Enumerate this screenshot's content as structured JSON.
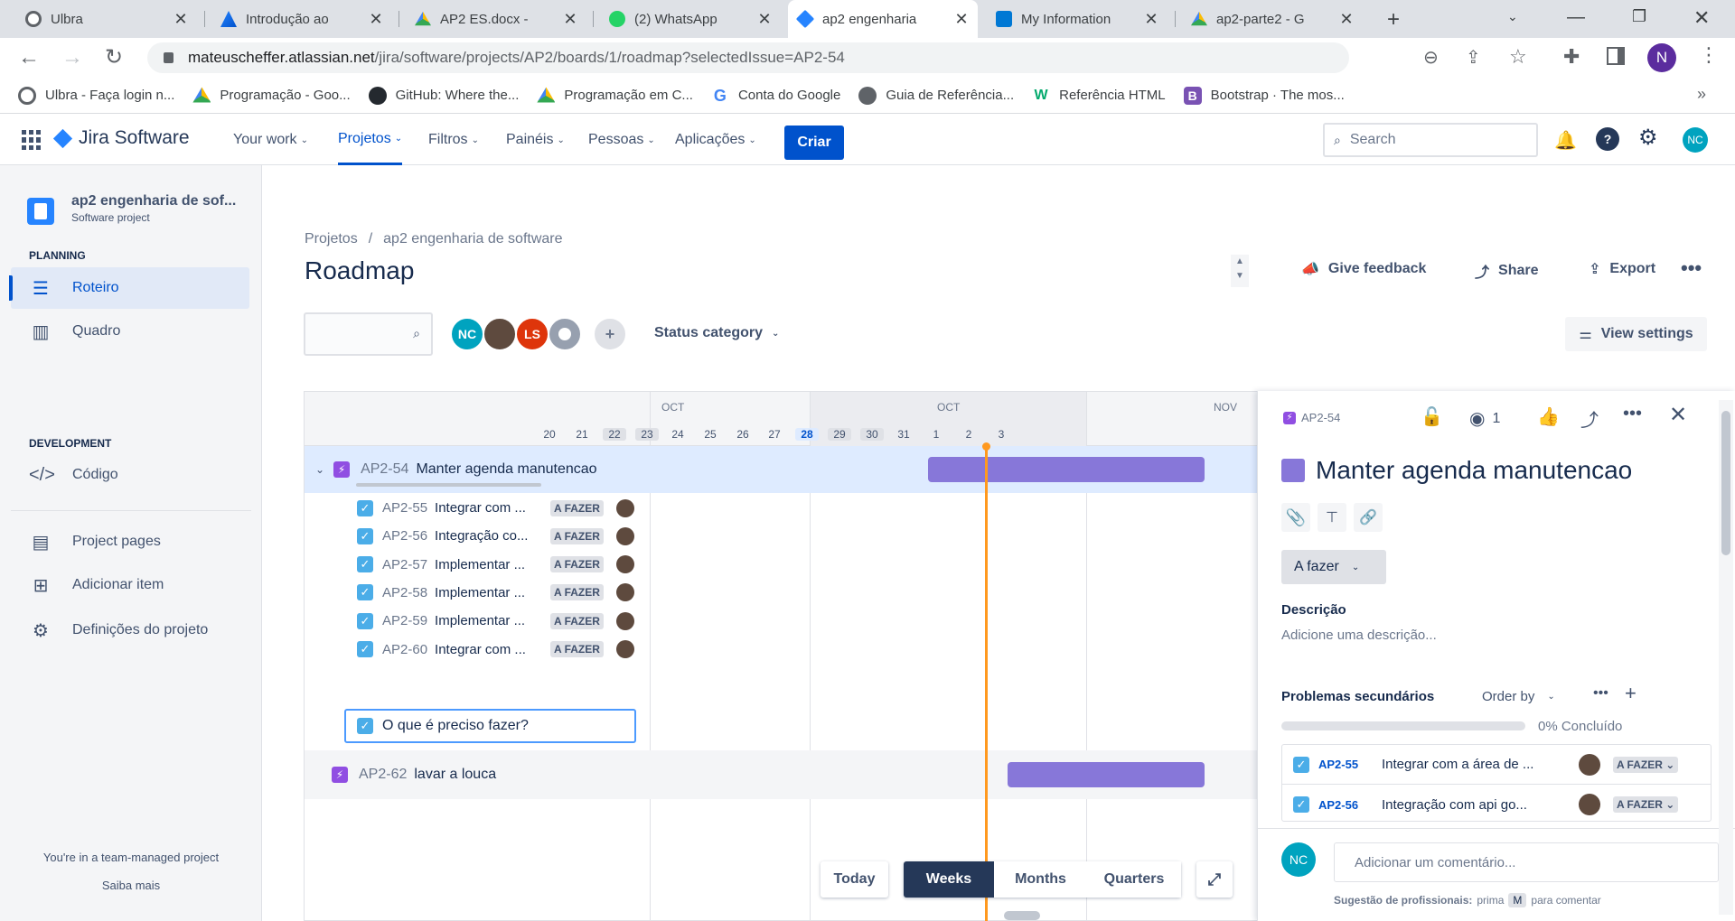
{
  "browser": {
    "tabs": [
      {
        "title": "Ulbra",
        "icon": "openai-icon",
        "active": false
      },
      {
        "title": "Introdução ao",
        "icon": "atlassian-icon",
        "active": false
      },
      {
        "title": "AP2 ES.docx - ",
        "icon": "google-drive-icon",
        "active": false
      },
      {
        "title": "(2) WhatsApp",
        "icon": "whatsapp-icon",
        "active": false
      },
      {
        "title": "ap2 engenharia",
        "icon": "jira-icon",
        "active": true
      },
      {
        "title": "My Information",
        "icon": "azure-devops-icon",
        "active": false
      },
      {
        "title": "ap2-parte2 - G",
        "icon": "google-drive-icon",
        "active": false
      }
    ],
    "url_host": "mateuscheffer.atlassian.net",
    "url_path": "/jira/software/projects/AP2/boards/1/roadmap?selectedIssue=AP2-54",
    "profile_initial": "N",
    "bookmarks": [
      {
        "label": "Ulbra - Faça login n...",
        "icon": "openai-icon"
      },
      {
        "label": "Programação - Goo...",
        "icon": "google-drive-icon"
      },
      {
        "label": "GitHub: Where the...",
        "icon": "github-icon"
      },
      {
        "label": "Programação em C...",
        "icon": "google-drive-icon"
      },
      {
        "label": "Conta do Google",
        "icon": "google-icon"
      },
      {
        "label": "Guia de Referência...",
        "icon": "globe-icon"
      },
      {
        "label": "Referência HTML",
        "icon": "w3schools-icon"
      },
      {
        "label": "Bootstrap · The mos...",
        "icon": "bootstrap-icon"
      }
    ]
  },
  "jira": {
    "product": "Jira Software",
    "nav": [
      "Your work",
      "Projetos",
      "Filtros",
      "Painéis",
      "Pessoas",
      "Aplicações"
    ],
    "create_label": "Criar",
    "search_placeholder": "Search",
    "user_initials": "NC"
  },
  "sidebar": {
    "project_name": "ap2 engenharia de sof...",
    "project_type": "Software project",
    "planning_head": "PLANNING",
    "development_head": "DEVELOPMENT",
    "items": [
      {
        "label": "Roteiro",
        "icon": "roadmap-icon"
      },
      {
        "label": "Quadro",
        "icon": "board-icon"
      },
      {
        "label": "Código",
        "icon": "code-icon"
      },
      {
        "label": "Project pages",
        "icon": "page-icon"
      },
      {
        "label": "Adicionar item",
        "icon": "add-item-icon"
      },
      {
        "label": "Definições do projeto",
        "icon": "settings-icon"
      }
    ],
    "footer_note": "You're in a team-managed project",
    "footer_link": "Saiba mais"
  },
  "main": {
    "breadcrumb_root": "Projetos",
    "breadcrumb_sep": "/",
    "breadcrumb_project": "ap2 engenharia de software",
    "title": "Roadmap",
    "give_feedback": "Give feedback",
    "share": "Share",
    "export": "Export",
    "status_category": "Status category",
    "view_settings": "View settings",
    "avatars": [
      "NC",
      "",
      "LS",
      ""
    ]
  },
  "roadmap": {
    "months": [
      "OCT",
      "OCT",
      "NOV"
    ],
    "days": [
      "20",
      "21",
      "22",
      "23",
      "24",
      "25",
      "26",
      "27",
      "28",
      "29",
      "30",
      "31",
      "1",
      "2",
      "3"
    ],
    "weekend_days": [
      "22",
      "23",
      "29",
      "30"
    ],
    "today_day": "28",
    "epic": {
      "key": "AP2-54",
      "title": "Manter agenda manutencao"
    },
    "children": [
      {
        "key": "AP2-55",
        "title": "Integrar com ...",
        "status": "A FAZER"
      },
      {
        "key": "AP2-56",
        "title": "Integração co...",
        "status": "A FAZER"
      },
      {
        "key": "AP2-57",
        "title": "Implementar ...",
        "status": "A FAZER"
      },
      {
        "key": "AP2-58",
        "title": "Implementar ...",
        "status": "A FAZER"
      },
      {
        "key": "AP2-59",
        "title": "Implementar ...",
        "status": "A FAZER"
      },
      {
        "key": "AP2-60",
        "title": "Integrar com ...",
        "status": "A FAZER"
      }
    ],
    "new_child_placeholder": "O que é preciso fazer?",
    "epic2": {
      "key": "AP2-62",
      "title": "lavar a louca"
    },
    "timescale": {
      "today": "Today",
      "weeks": "Weeks",
      "months": "Months",
      "quarters": "Quarters",
      "selected": "Weeks"
    }
  },
  "detail": {
    "key": "AP2-54",
    "watchers": "1",
    "title": "Manter agenda manutencao",
    "status": "A fazer",
    "description_label": "Descrição",
    "description_placeholder": "Adicione uma descrição...",
    "child_issues_label": "Problemas secundários",
    "order_by": "Order by",
    "progress_text": "0% Concluído",
    "children": [
      {
        "key": "AP2-55",
        "title": "Integrar com a área de ...",
        "status": "A FAZER"
      },
      {
        "key": "AP2-56",
        "title": "Integração com api go...",
        "status": "A FAZER"
      }
    ],
    "comment_placeholder": "Adicionar um comentário...",
    "tip_bold": "Sugestão de profissionais:",
    "tip_text": "prima",
    "tip_key": "M",
    "tip_suffix": "para comentar",
    "user_initials": "NC"
  },
  "colors": {
    "jira_blue": "#0052cc",
    "epic_bar": "#8777d9",
    "today_line": "#ff991f"
  }
}
